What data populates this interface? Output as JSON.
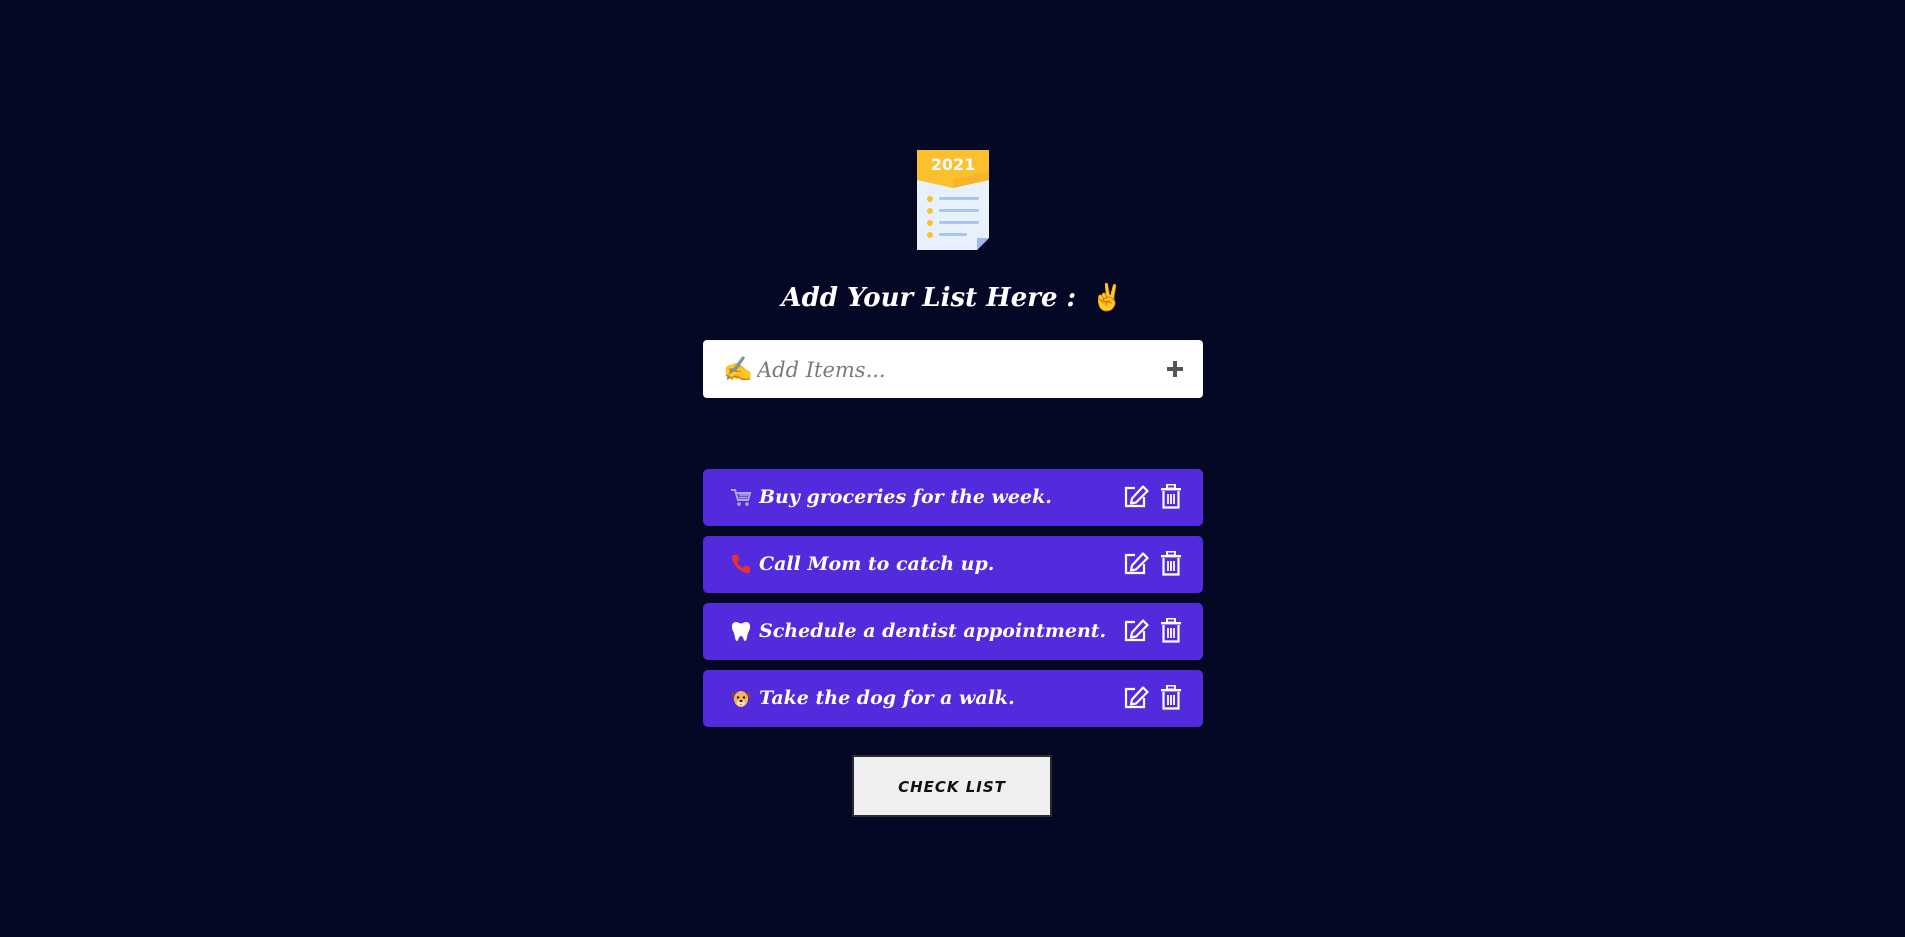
{
  "logo": {
    "year": "2021",
    "icon": "todo-list-icon"
  },
  "heading": {
    "text": "Add Your List Here :",
    "emoji": "✌️"
  },
  "add_box": {
    "placeholder": "Add Items...",
    "prefix_emoji": "✍️",
    "add_icon": "plus-icon"
  },
  "items": [
    {
      "icon": "shopping-cart-icon",
      "text": "Buy groceries for the week."
    },
    {
      "icon": "telephone-icon",
      "text": "Call Mom to catch up."
    },
    {
      "icon": "tooth-icon",
      "text": "Schedule a dentist appointment."
    },
    {
      "icon": "dog-icon",
      "text": "Take the dog for a walk."
    }
  ],
  "check_button": {
    "label": "CHECK LIST"
  },
  "colors": {
    "background": "#050824",
    "item_bg": "#532bdc",
    "logo_accent": "#fbc02d"
  }
}
